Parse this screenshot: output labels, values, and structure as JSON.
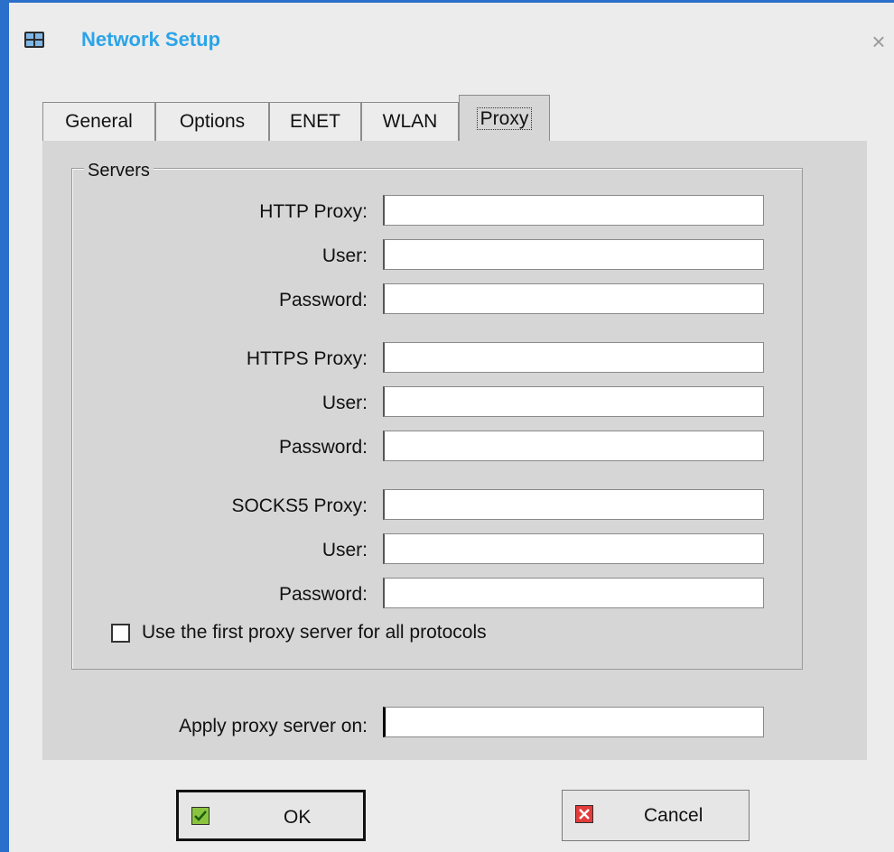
{
  "window": {
    "title": "Network Setup"
  },
  "tabs": [
    {
      "label": "General",
      "underline": "G"
    },
    {
      "label": "Options",
      "underline": "t"
    },
    {
      "label": "ENET",
      "underline": "E"
    },
    {
      "label": "WLAN",
      "underline": "W"
    },
    {
      "label": "Proxy",
      "underline": "y",
      "active": true
    }
  ],
  "servers_group": {
    "title": "Servers",
    "http": {
      "proxy_label": "HTTP Proxy:",
      "proxy_value": "",
      "user_label": "User:",
      "user_value": "",
      "password_label": "Password:",
      "password_value": ""
    },
    "https": {
      "proxy_label": "HTTPS Proxy:",
      "proxy_value": "",
      "user_label": "User:",
      "user_value": "",
      "password_label": "Password:",
      "password_value": ""
    },
    "socks5": {
      "proxy_label": "SOCKS5 Proxy:",
      "proxy_value": "",
      "user_label": "User:",
      "user_value": "",
      "password_label": "Password:",
      "password_value": ""
    },
    "use_first_proxy": {
      "label": "Use the first proxy server for all protocols",
      "checked": false
    }
  },
  "apply_proxy": {
    "label": "Apply proxy server on:",
    "value": ""
  },
  "buttons": {
    "ok": "OK",
    "cancel": "Cancel"
  },
  "icons": {
    "app": "network-icon",
    "close": "close-icon",
    "ok": "checkmark-icon",
    "cancel": "x-icon"
  },
  "colors": {
    "title": "#2ba4e8",
    "frame": "#2a6fc9"
  }
}
